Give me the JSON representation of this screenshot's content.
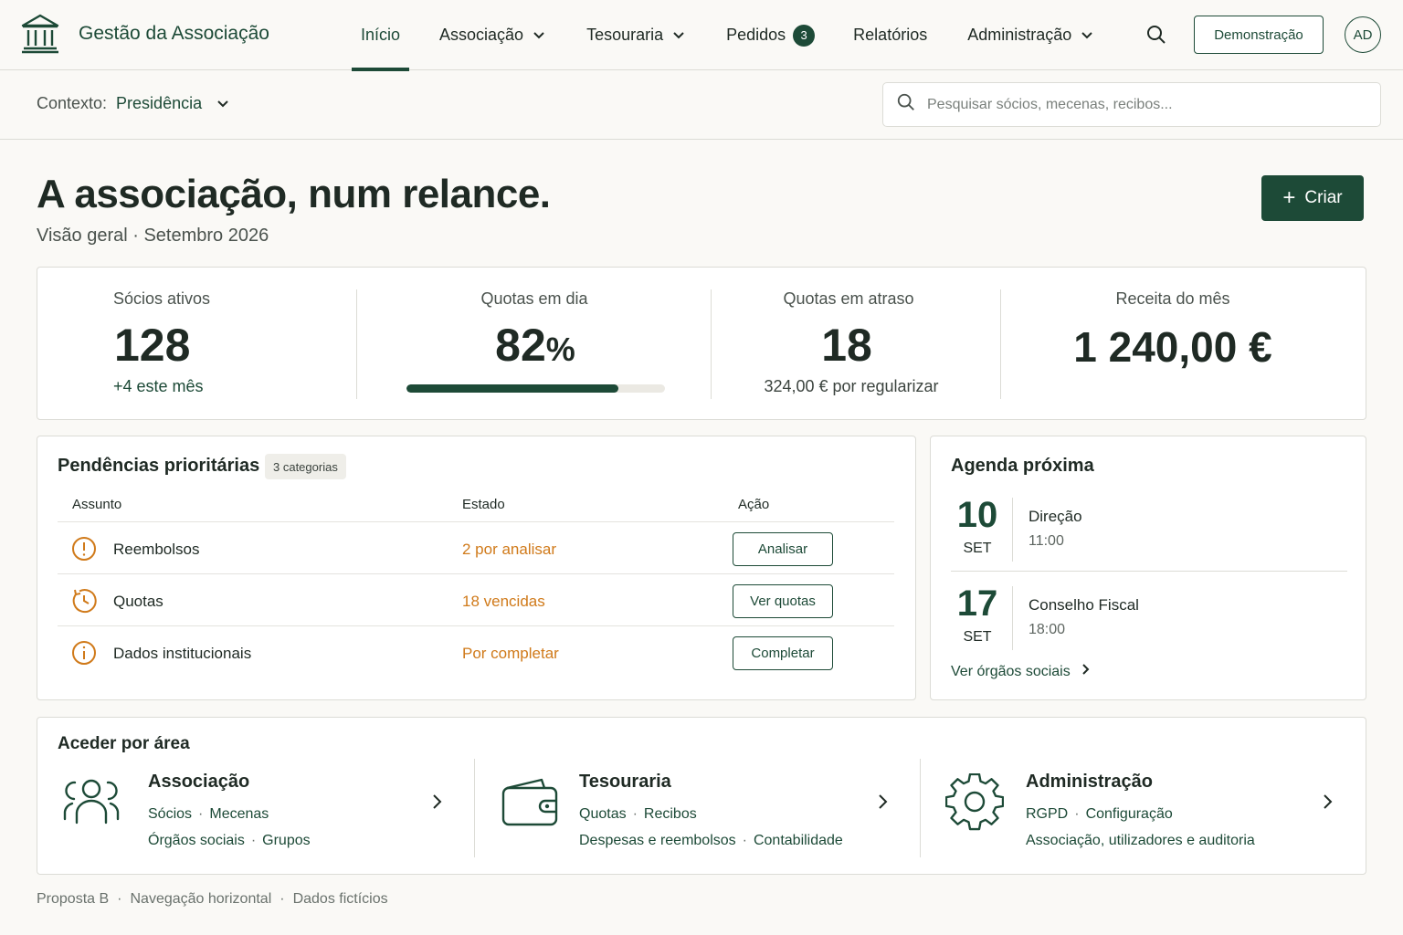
{
  "header": {
    "brand": "Gestão da Associação",
    "nav": [
      {
        "label": "Início",
        "active": true
      },
      {
        "label": "Associação",
        "dropdown": true
      },
      {
        "label": "Tesouraria",
        "dropdown": true
      },
      {
        "label": "Pedidos",
        "badge": "3"
      },
      {
        "label": "Relatórios"
      },
      {
        "label": "Administração",
        "dropdown": true
      }
    ],
    "demo_label": "Demonstração",
    "avatar_initials": "AD"
  },
  "context": {
    "label": "Contexto:",
    "value": "Presidência",
    "search_placeholder": "Pesquisar sócios, mecenas, recibos..."
  },
  "page": {
    "title": "A associação, num relance.",
    "subtitle": "Visão geral · Setembro 2026",
    "create_label": "Criar"
  },
  "stats": [
    {
      "label": "Sócios ativos",
      "value": "128",
      "sub": "+4 este mês"
    },
    {
      "label": "Quotas em dia",
      "value": "82",
      "unit": "%",
      "progress": 0.82
    },
    {
      "label": "Quotas em atraso",
      "value": "18",
      "sub": "324,00 € por regularizar"
    },
    {
      "label": "Receita do mês",
      "value": "1 240,00 €"
    }
  ],
  "pending": {
    "title": "Pendências prioritárias",
    "chip": "3 categorias",
    "columns": [
      "Assunto",
      "Estado",
      "Ação"
    ],
    "rows": [
      {
        "icon": "alert-circle-icon",
        "subject": "Reembolsos",
        "status": "2 por analisar",
        "action": "Analisar"
      },
      {
        "icon": "clock-icon",
        "subject": "Quotas",
        "status": "18 vencidas",
        "action": "Ver quotas"
      },
      {
        "icon": "info-circle-icon",
        "subject": "Dados institucionais",
        "status": "Por completar",
        "action": "Completar"
      }
    ]
  },
  "agenda": {
    "title": "Agenda próxima",
    "events": [
      {
        "day": "10",
        "month": "SET",
        "name": "Direção",
        "time": "11:00"
      },
      {
        "day": "17",
        "month": "SET",
        "name": "Conselho Fiscal",
        "time": "18:00"
      }
    ],
    "link": "Ver órgãos sociais"
  },
  "areas": {
    "title": "Aceder por área",
    "items": [
      {
        "name": "Associação",
        "icon": "users-icon",
        "line1": [
          "Sócios",
          "Mecenas"
        ],
        "line2": [
          "Órgãos sociais",
          "Grupos"
        ]
      },
      {
        "name": "Tesouraria",
        "icon": "wallet-icon",
        "line1": [
          "Quotas",
          "Recibos"
        ],
        "line2": [
          "Despesas e reembolsos",
          "Contabilidade"
        ]
      },
      {
        "name": "Administração",
        "icon": "gear-icon",
        "line1": [
          "RGPD",
          "Configuração"
        ],
        "line2": [
          "Associação, utilizadores e auditoria"
        ]
      }
    ]
  },
  "footer": [
    "Proposta B",
    "Navegação horizontal",
    "Dados fictícios"
  ],
  "colors": {
    "brand": "#1d4a37",
    "warning": "#d07a1a",
    "background": "#faf9f6"
  }
}
